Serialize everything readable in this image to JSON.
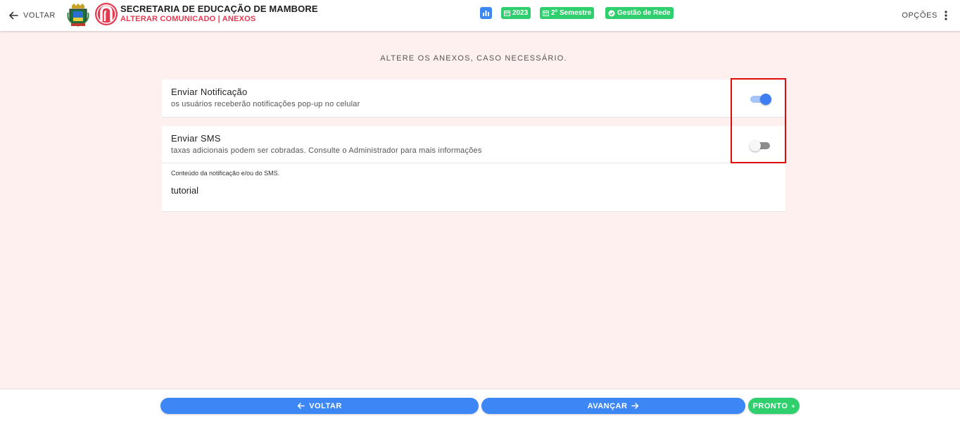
{
  "header": {
    "back_label": "VOLTAR",
    "title": "SECRETARIA DE EDUCAÇÃO DE MAMBORE",
    "subtitle": "ALTERAR COMUNICADO | ANEXOS",
    "chips": {
      "year": "2023",
      "semester": "2º Semestre",
      "network": "Gestão de Rede"
    },
    "options_label": "OPÇÕES"
  },
  "main": {
    "instruction": "ALTERE OS ANEXOS, CASO NECESSÁRIO.",
    "notification": {
      "title": "Enviar Notificação",
      "description": "os usuários receberão notificações pop-up no celular",
      "enabled": true
    },
    "sms": {
      "title": "Enviar SMS",
      "description": "taxas adicionais podem ser cobradas. Consulte o Administrador para mais informações",
      "enabled": false
    },
    "content": {
      "label": "Conteúdo da notificação e/ou do SMS.",
      "value": "tutorial"
    }
  },
  "footer": {
    "back_label": "VOLTAR",
    "next_label": "AVANÇAR",
    "done_label": "PRONTO"
  },
  "colors": {
    "accent_blue": "#3d86f5",
    "accent_green": "#2fcf6d",
    "brand_red": "#e53950",
    "highlight_red": "#e10a0a",
    "background": "#fdf0ef"
  }
}
